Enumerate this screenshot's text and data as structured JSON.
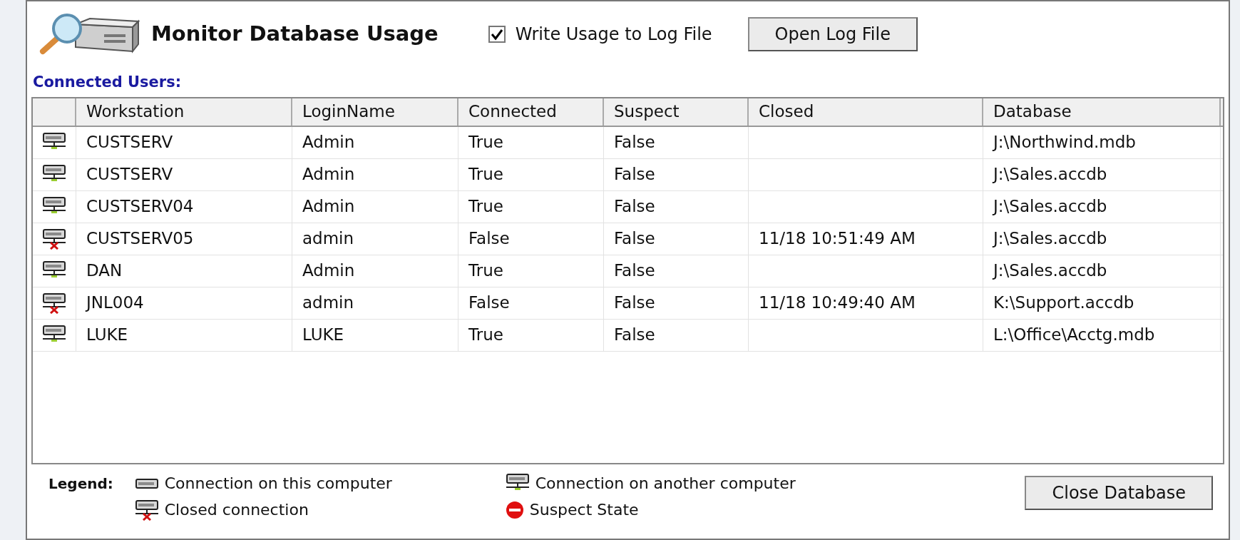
{
  "header": {
    "title": "Monitor Database Usage",
    "log_checkbox": {
      "label": "Write Usage to Log File",
      "checked": true
    },
    "open_button": "Open Log File"
  },
  "section_label": "Connected Users:",
  "table": {
    "columns": [
      "Workstation",
      "LoginName",
      "Connected",
      "Suspect",
      "Closed",
      "Database"
    ],
    "rows": [
      {
        "kind": "another",
        "cells": [
          "CUSTSERV",
          "Admin",
          "True",
          "False",
          "",
          "J:\\Northwind.mdb"
        ]
      },
      {
        "kind": "another",
        "cells": [
          "CUSTSERV",
          "Admin",
          "True",
          "False",
          "",
          "J:\\Sales.accdb"
        ]
      },
      {
        "kind": "another",
        "cells": [
          "CUSTSERV04",
          "Admin",
          "True",
          "False",
          "",
          "J:\\Sales.accdb"
        ]
      },
      {
        "kind": "closed",
        "cells": [
          "CUSTSERV05",
          "admin",
          "False",
          "False",
          "11/18 10:51:49 AM",
          "J:\\Sales.accdb"
        ]
      },
      {
        "kind": "another",
        "cells": [
          "DAN",
          "Admin",
          "True",
          "False",
          "",
          "J:\\Sales.accdb"
        ]
      },
      {
        "kind": "closed",
        "cells": [
          "JNL004",
          "admin",
          "False",
          "False",
          "11/18 10:49:40 AM",
          "K:\\Support.accdb"
        ]
      },
      {
        "kind": "another",
        "cells": [
          "LUKE",
          "LUKE",
          "True",
          "False",
          "",
          "L:\\Office\\Acctg.mdb"
        ]
      }
    ]
  },
  "legend": {
    "label": "Legend:",
    "items": [
      {
        "kind": "this",
        "label": "Connection on this computer"
      },
      {
        "kind": "another",
        "label": "Connection on another computer"
      },
      {
        "kind": "closed",
        "label": "Closed connection"
      },
      {
        "kind": "suspect",
        "label": "Suspect State"
      }
    ]
  },
  "close_button": "Close Database"
}
